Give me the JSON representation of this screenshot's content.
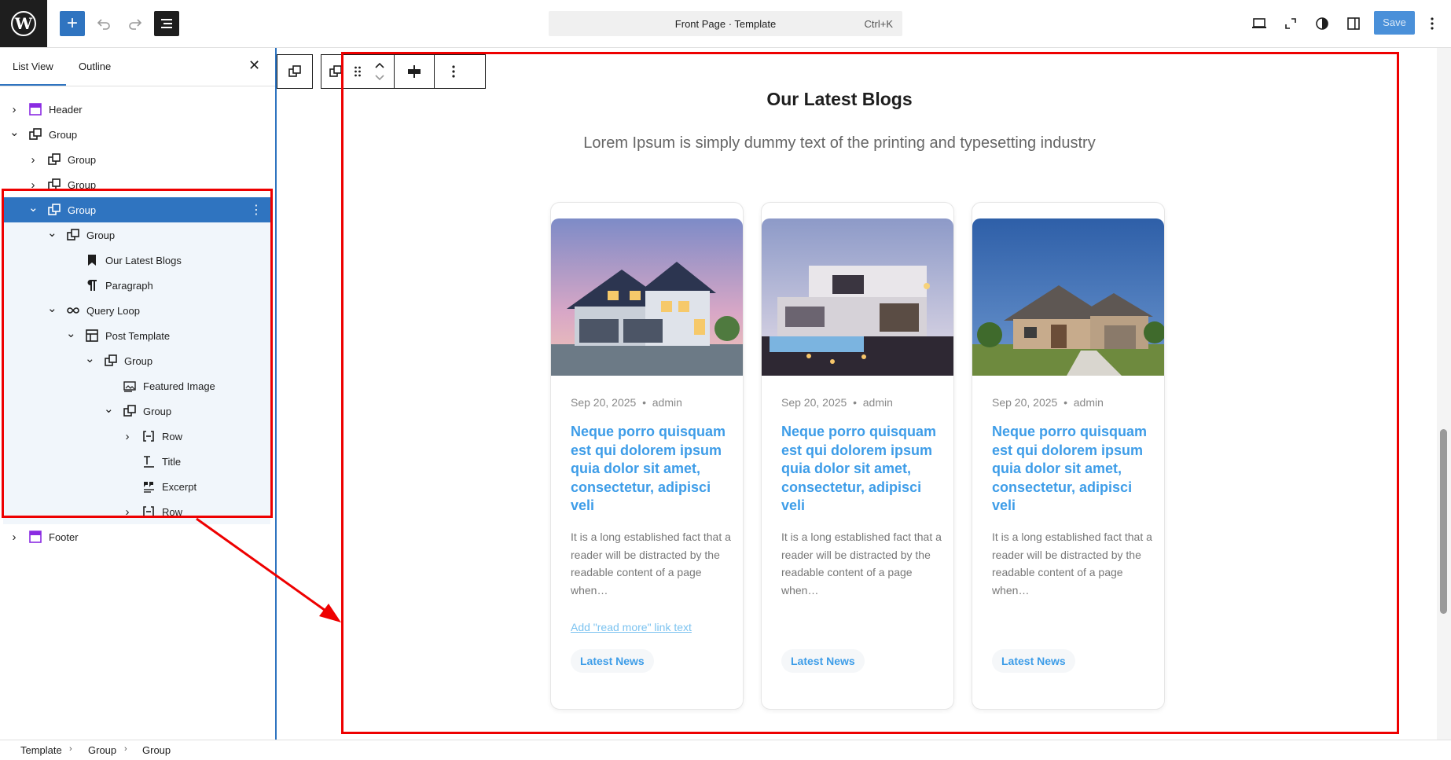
{
  "header": {
    "command_title": "Front Page · Template",
    "command_shortcut": "Ctrl+K",
    "save_label": "Save"
  },
  "sidebar": {
    "tabs": [
      "List View",
      "Outline"
    ],
    "tree": [
      {
        "label": "Header",
        "icon": "template-part-icon",
        "expand": "collapsed",
        "selected": false
      },
      {
        "label": "Group",
        "icon": "group-icon",
        "expand": "expanded",
        "selected": false
      },
      {
        "label": "Group",
        "icon": "group-icon",
        "expand": "collapsed",
        "selected": false
      },
      {
        "label": "Group",
        "icon": "group-icon",
        "expand": "collapsed",
        "selected": false
      },
      {
        "label": "Group",
        "icon": "group-icon",
        "expand": "expanded",
        "selected": true
      },
      {
        "label": "Group",
        "icon": "group-icon",
        "expand": "expanded",
        "selected": false
      },
      {
        "label": "Our Latest Blogs",
        "icon": "heading-bookmark-icon",
        "expand": "none",
        "selected": false
      },
      {
        "label": "Paragraph",
        "icon": "paragraph-icon",
        "expand": "none",
        "selected": false
      },
      {
        "label": "Query Loop",
        "icon": "loop-icon",
        "expand": "expanded",
        "selected": false
      },
      {
        "label": "Post Template",
        "icon": "layout-icon",
        "expand": "expanded",
        "selected": false
      },
      {
        "label": "Group",
        "icon": "group-icon",
        "expand": "expanded",
        "selected": false
      },
      {
        "label": "Featured Image",
        "icon": "image-icon",
        "expand": "none",
        "selected": false
      },
      {
        "label": "Group",
        "icon": "group-icon",
        "expand": "expanded",
        "selected": false
      },
      {
        "label": "Row",
        "icon": "row-icon",
        "expand": "collapsed",
        "selected": false
      },
      {
        "label": "Title",
        "icon": "title-icon",
        "expand": "none",
        "selected": false
      },
      {
        "label": "Excerpt",
        "icon": "excerpt-icon",
        "expand": "none",
        "selected": false
      },
      {
        "label": "Row",
        "icon": "row-icon",
        "expand": "collapsed",
        "selected": false
      },
      {
        "label": "Footer",
        "icon": "template-part-icon",
        "expand": "collapsed",
        "selected": false
      }
    ]
  },
  "content": {
    "section_title": "Our Latest Blogs",
    "section_subtitle": "Lorem Ipsum is simply dummy text of the printing and typesetting industry",
    "cards": [
      {
        "date": "Sep 20, 2025",
        "author": "admin",
        "title": "Neque porro quisquam est qui dolorem ipsum quia dolor sit amet, consectetur, adipisci veli",
        "excerpt": "It is a long established fact that a reader will be distracted by the readable content of a page when…",
        "read_more": "Add \"read more\" link text",
        "category": "Latest News"
      },
      {
        "date": "Sep 20, 2025",
        "author": "admin",
        "title": "Neque porro quisquam est qui dolorem ipsum quia dolor sit amet, consectetur, adipisci veli",
        "excerpt": "It is a long established fact that a reader will be distracted by the readable content of a page when…",
        "read_more": "",
        "category": "Latest News"
      },
      {
        "date": "Sep 20, 2025",
        "author": "admin",
        "title": "Neque porro quisquam est qui dolorem ipsum quia dolor sit amet, consectetur, adipisci veli",
        "excerpt": "It is a long established fact that a reader will be distracted by the readable content of a page when…",
        "read_more": "",
        "category": "Latest News"
      }
    ]
  },
  "breadcrumbs": [
    "Template",
    "Group",
    "Group"
  ],
  "colors": {
    "accent": "#2f74c0",
    "link": "#3e9de8",
    "highlight": "#ee0000"
  }
}
